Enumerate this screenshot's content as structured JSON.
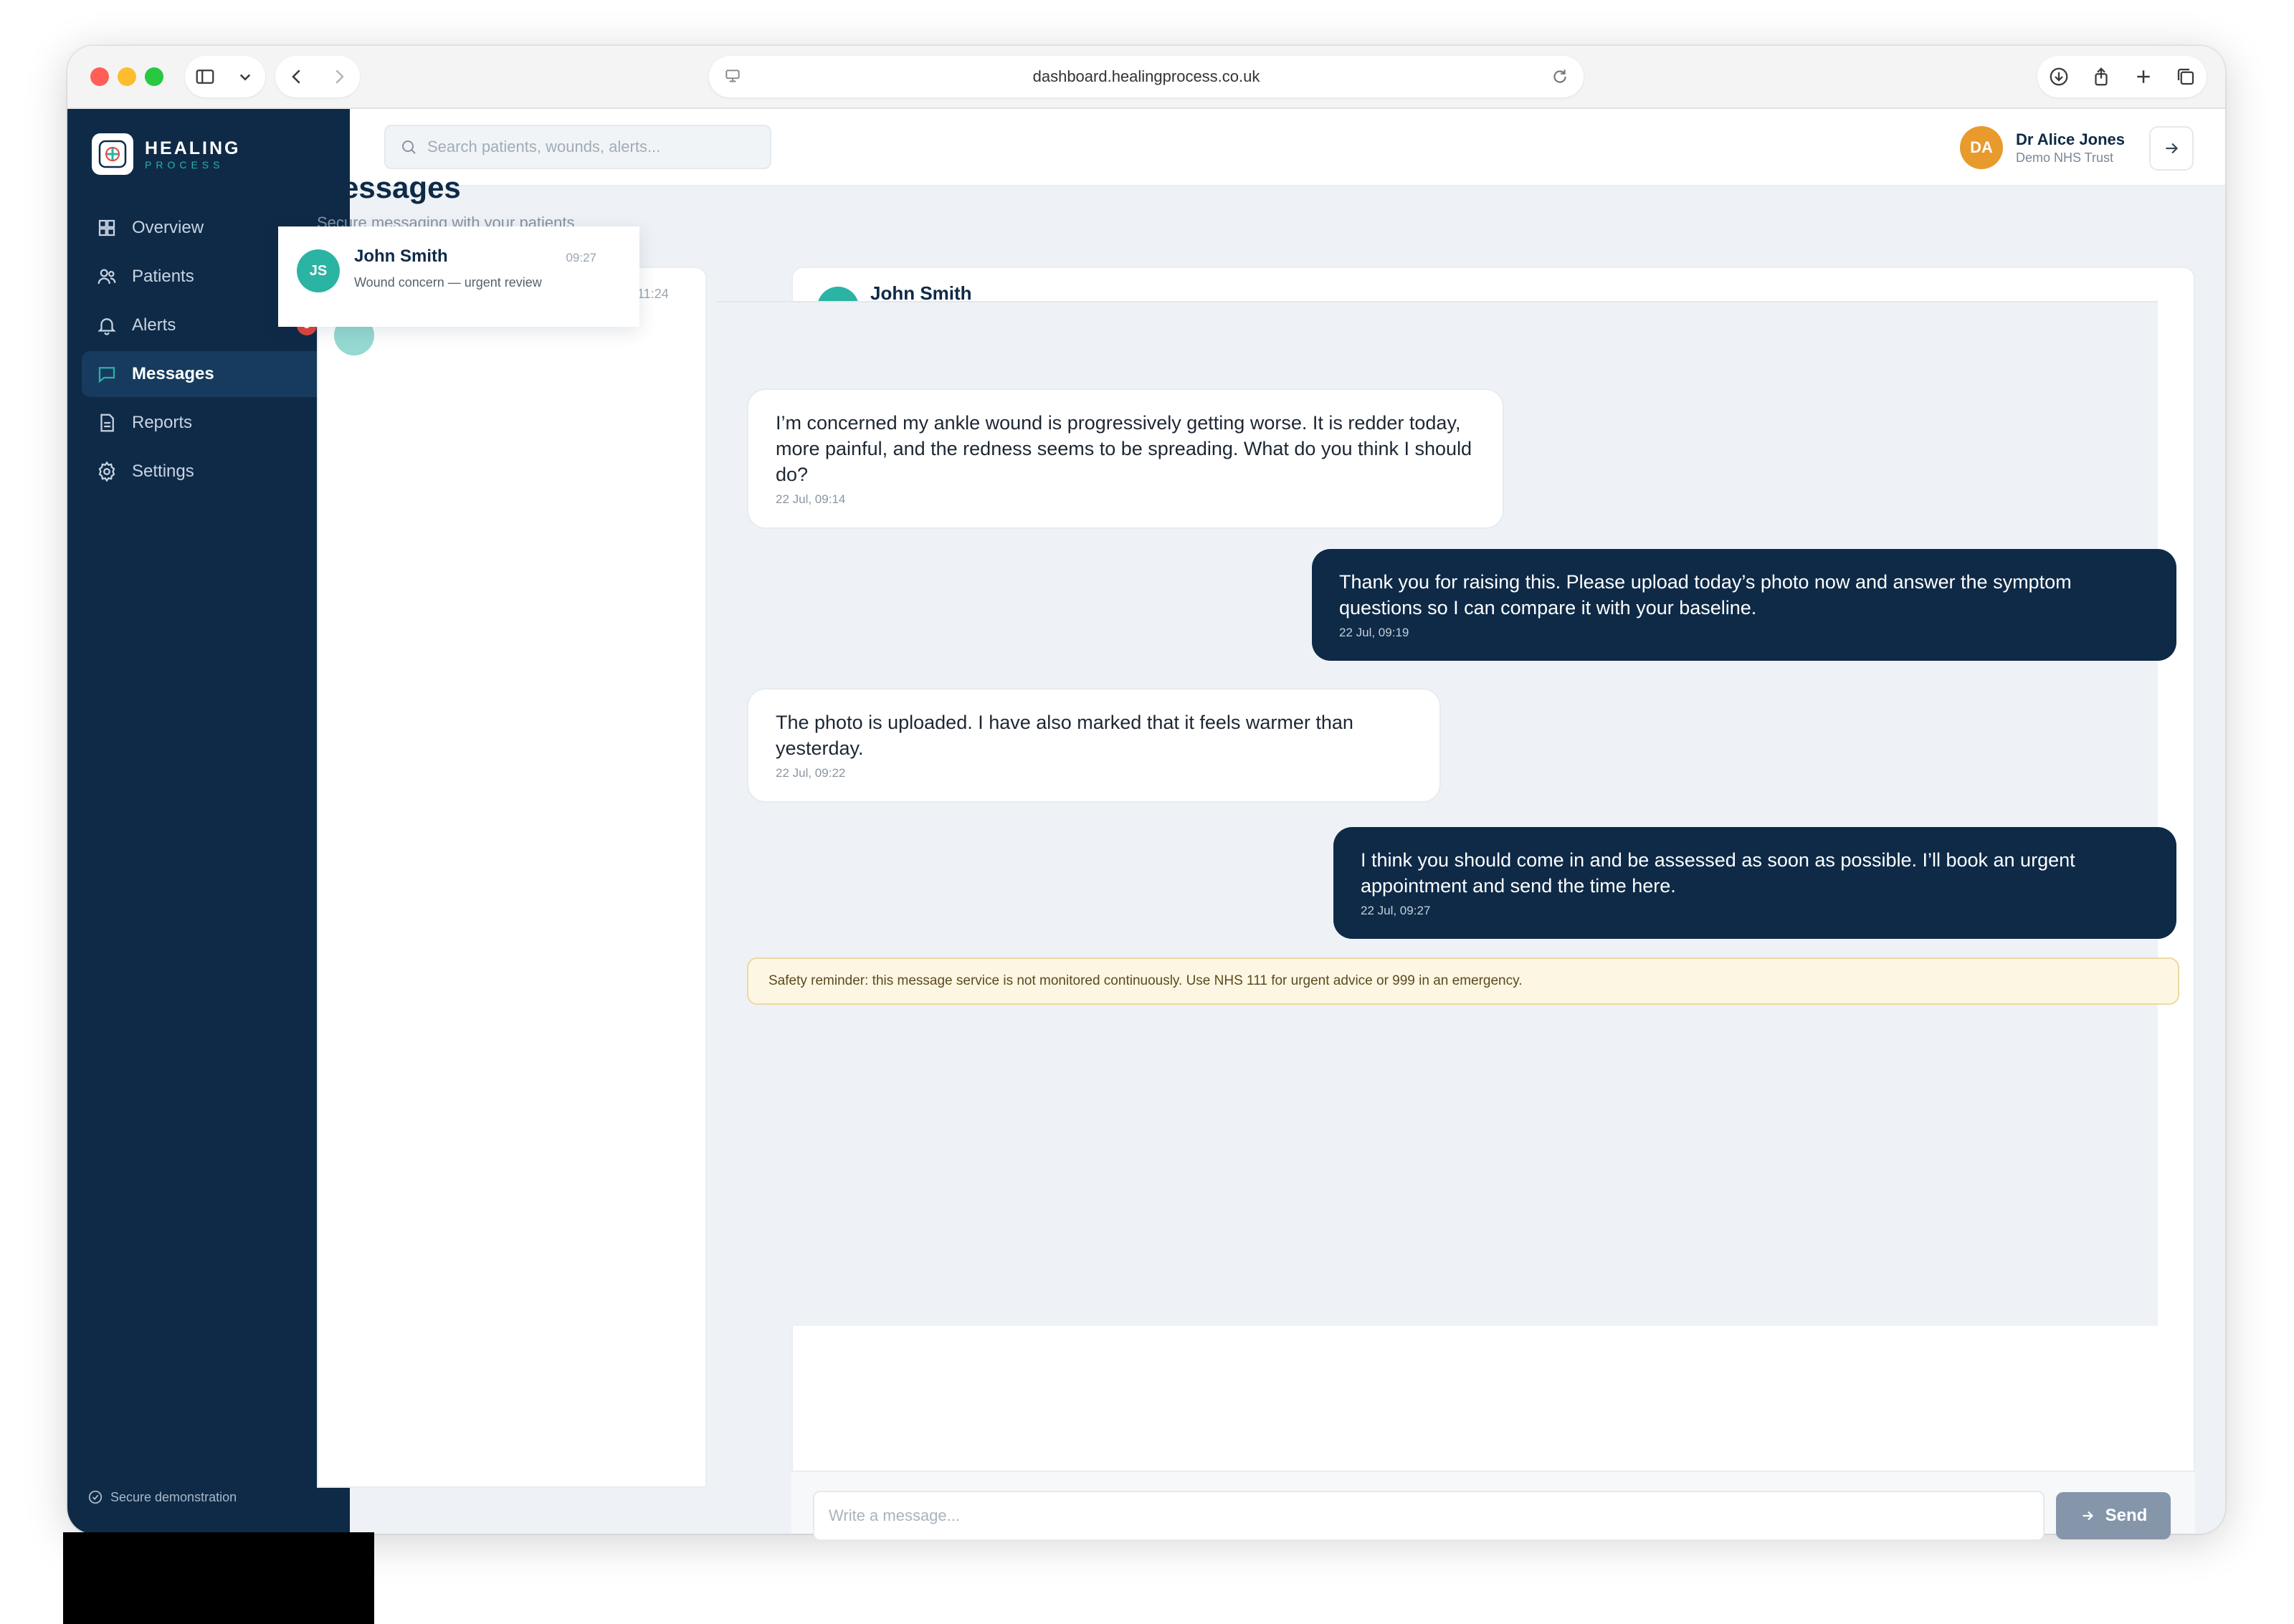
{
  "browser": {
    "url": "dashboard.healingprocess.co.uk"
  },
  "brand": {
    "name": "HEALING",
    "sub": "PROCESS"
  },
  "sidebar": {
    "items": [
      {
        "label": "Overview",
        "icon": "grid-icon"
      },
      {
        "label": "Patients",
        "icon": "users-icon"
      },
      {
        "label": "Alerts",
        "icon": "bell-icon",
        "badge": "3"
      },
      {
        "label": "Messages",
        "icon": "message-icon",
        "active": true
      },
      {
        "label": "Reports",
        "icon": "document-icon"
      },
      {
        "label": "Settings",
        "icon": "gear-icon"
      }
    ],
    "footer": "Secure demonstration"
  },
  "header": {
    "search_placeholder": "Search patients, wounds, alerts...",
    "user": {
      "initials": "DA",
      "name": "Dr Alice Jones",
      "org": "Demo NHS Trust"
    }
  },
  "page": {
    "title": "Messages",
    "subtitle": "Secure messaging with your patients"
  },
  "thread_list": {
    "selected": {
      "initials": "JS",
      "name": "John Smith",
      "time": "09:27",
      "preview": "Wound concern — urgent review"
    },
    "behind_time": "ıl, 11:24"
  },
  "conversation": {
    "patient_initials": "JS",
    "patient_name": "John Smith",
    "messages": [
      {
        "direction": "in",
        "text": "I’m concerned my ankle wound is progressively getting worse. It is redder today, more painful, and the redness seems to be spreading. What do you think I should do?",
        "time": "22 Jul, 09:14"
      },
      {
        "direction": "out",
        "text": "Thank you for raising this. Please upload today’s photo now and answer the symptom questions so I can compare it with your baseline.",
        "time": "22 Jul, 09:19"
      },
      {
        "direction": "in",
        "text": "The photo is uploaded. I have also marked that it feels warmer than yesterday.",
        "time": "22 Jul, 09:22"
      },
      {
        "direction": "out",
        "text": "I think you should come in and be assessed as soon as possible. I’ll book an urgent appointment and send the time here.",
        "time": "22 Jul, 09:27"
      }
    ],
    "safety_reminder": "Safety reminder: this message service is not monitored continuously. Use NHS 111 for urgent advice or 999 in an emergency.",
    "composer_placeholder": "Write a message...",
    "send_label": "Send"
  },
  "colors": {
    "sidebar": "#0e2a47",
    "accent": "#2bb3a3",
    "badge": "#e0463f",
    "avatar_user": "#e89a2c",
    "bubble_out": "#0e2a47"
  }
}
